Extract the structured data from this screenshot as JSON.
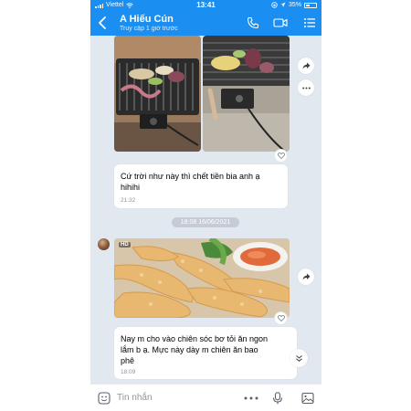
{
  "status_bar": {
    "carrier": "Viettel",
    "time": "13:41",
    "battery": "35%"
  },
  "header": {
    "contact_name": "A Hiếu Cún",
    "contact_status": "Truy cập 1 giờ trước",
    "icons": [
      "back-arrow-icon",
      "phone-icon",
      "video-camera-icon",
      "list-menu-icon"
    ]
  },
  "messages": [
    {
      "type": "images",
      "images": [
        "grilled-seafood-photo-left",
        "grilled-seafood-photo-right"
      ],
      "actions": [
        "share-icon",
        "more-icon",
        "heart-icon"
      ]
    },
    {
      "type": "text",
      "text": "Cứ trời như này thì chết tiền bia anh ạ hihihi",
      "time": "21:32"
    },
    {
      "type": "date_separator",
      "text": "18:08 16/06/2021"
    },
    {
      "type": "image",
      "badge": "HD",
      "image": "fried-squid-photo",
      "actions": [
        "share-icon",
        "heart-icon"
      ]
    },
    {
      "type": "text",
      "text": "Nay m  cho vào chiên sóc bơ tỏi ăn ngon lắm b ạ. Mực này dày m chiên ăn bao phê",
      "time": "18:09"
    }
  ],
  "composer": {
    "placeholder": "Tin nhắn",
    "icons": [
      "sticker-icon",
      "more-dots-icon",
      "microphone-icon",
      "image-icon"
    ]
  },
  "colors": {
    "header_blue": "#1b8ef2",
    "chat_background": "#e2e8f0",
    "bubble": "#ffffff"
  }
}
